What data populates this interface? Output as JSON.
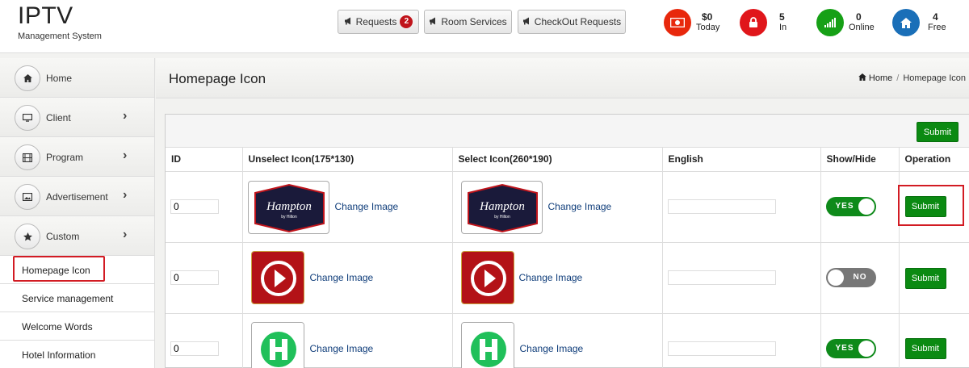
{
  "brand": {
    "title": "IPTV",
    "subtitle": "Management System"
  },
  "header": {
    "requests_label": "Requests",
    "requests_count": "2",
    "room_services_label": "Room Services",
    "checkout_label": "CheckOut Requests",
    "stats": [
      {
        "value": "$0",
        "label": "Today",
        "color": "#e8280c",
        "icon": "money-icon"
      },
      {
        "value": "5",
        "label": "In",
        "color": "#e0161b",
        "icon": "lock-icon"
      },
      {
        "value": "0",
        "label": "Online",
        "color": "#16a016",
        "icon": "signal-icon"
      },
      {
        "value": "4",
        "label": "Free",
        "color": "#1a6fb8",
        "icon": "home-icon"
      }
    ]
  },
  "sidebar": {
    "items": [
      {
        "label": "Home",
        "icon": "home-icon"
      },
      {
        "label": "Client",
        "icon": "monitor-icon"
      },
      {
        "label": "Program",
        "icon": "film-icon"
      },
      {
        "label": "Advertisement",
        "icon": "picture-icon"
      },
      {
        "label": "Custom",
        "icon": "star-icon"
      }
    ],
    "subitems": [
      "Homepage Icon",
      "Service management",
      "Welcome Words",
      "Hotel Information"
    ]
  },
  "main": {
    "title": "Homepage Icon",
    "breadcrumb_home": "Home",
    "breadcrumb_current": "Homepage Icon",
    "submit_top": "Submit",
    "columns": [
      "ID",
      "Unselect Icon(175*130)",
      "Select Icon(260*190)",
      "English",
      "Show/Hide",
      "Operation"
    ],
    "rows": [
      {
        "id": "0",
        "icon": "hampton-logo",
        "change_label": "Change Image",
        "toggle": "YES",
        "submit": "Submit"
      },
      {
        "id": "0",
        "icon": "play-icon",
        "change_label": "Change Image",
        "toggle": "NO",
        "submit": "Submit"
      },
      {
        "id": "0",
        "icon": "h-logo-icon",
        "change_label": "Change Image",
        "toggle": "YES",
        "submit": "Submit"
      }
    ]
  }
}
